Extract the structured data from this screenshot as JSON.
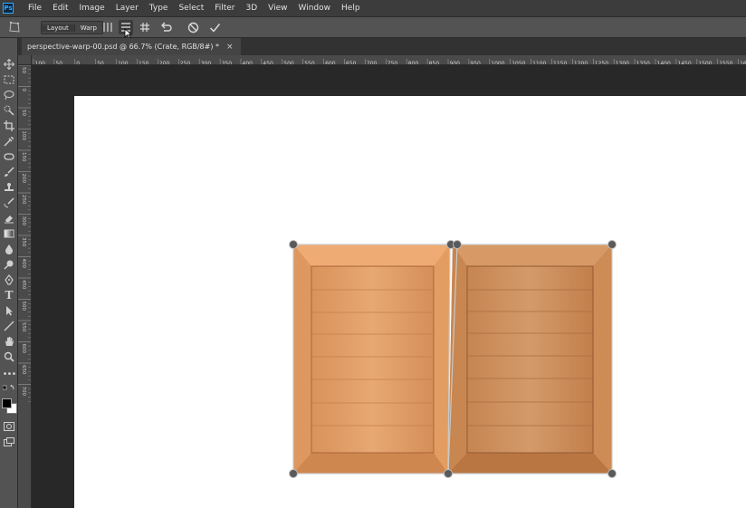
{
  "app": {
    "logo_text": "Ps"
  },
  "menu": [
    "File",
    "Edit",
    "Image",
    "Layer",
    "Type",
    "Select",
    "Filter",
    "3D",
    "View",
    "Window",
    "Help"
  ],
  "options": {
    "tool_icon": "perspective-warp-icon",
    "modes": [
      "Layout",
      "Warp"
    ],
    "active_mode": "Layout",
    "buttons": [
      {
        "name": "auto-straighten-vertical",
        "icon": "vertical-lines-icon"
      },
      {
        "name": "auto-level-horizontal",
        "icon": "horizontal-lines-icon"
      },
      {
        "name": "auto-straighten",
        "icon": "grid-icon"
      },
      {
        "name": "remove-warp",
        "icon": "undo-icon"
      },
      {
        "name": "cancel-warp",
        "icon": "cancel-icon"
      },
      {
        "name": "commit-warp",
        "icon": "check-icon"
      }
    ]
  },
  "document": {
    "tab_title": "perspective-warp-00.psd @ 66.7% (Crate, RGB/8#) *",
    "close_glyph": "×"
  },
  "ruler": {
    "horizontal_labels": [
      "100",
      "50",
      "0",
      "50",
      "100",
      "150",
      "200",
      "250",
      "300",
      "350",
      "400",
      "450",
      "500",
      "550",
      "600",
      "650",
      "700",
      "750",
      "800",
      "850",
      "900",
      "950",
      "1000",
      "1050",
      "1100",
      "1150",
      "1200",
      "1250",
      "1300",
      "1350",
      "1400",
      "1450",
      "1500",
      "1550",
      "1600",
      "1650"
    ],
    "vertical_labels": [
      "50",
      "0",
      "50",
      "100",
      "150",
      "200",
      "250",
      "300",
      "350",
      "400",
      "450",
      "500",
      "550",
      "600",
      "650",
      "700"
    ]
  },
  "colors": {
    "foreground": "#000000",
    "background": "#ffffff",
    "accent": "#31a8ff"
  },
  "tools": [
    "move-tool-icon",
    "marquee-tool-icon",
    "lasso-tool-icon",
    "quick-select-tool-icon",
    "crop-tool-icon",
    "eyedropper-tool-icon",
    "spot-healing-tool-icon",
    "brush-tool-icon",
    "clone-stamp-tool-icon",
    "history-brush-tool-icon",
    "eraser-tool-icon",
    "gradient-tool-icon",
    "blur-tool-icon",
    "dodge-tool-icon",
    "pen-tool-icon",
    "type-tool-icon",
    "path-selection-tool-icon",
    "line-tool-icon",
    "hand-tool-icon",
    "zoom-tool-icon",
    "more-tools-icon"
  ]
}
